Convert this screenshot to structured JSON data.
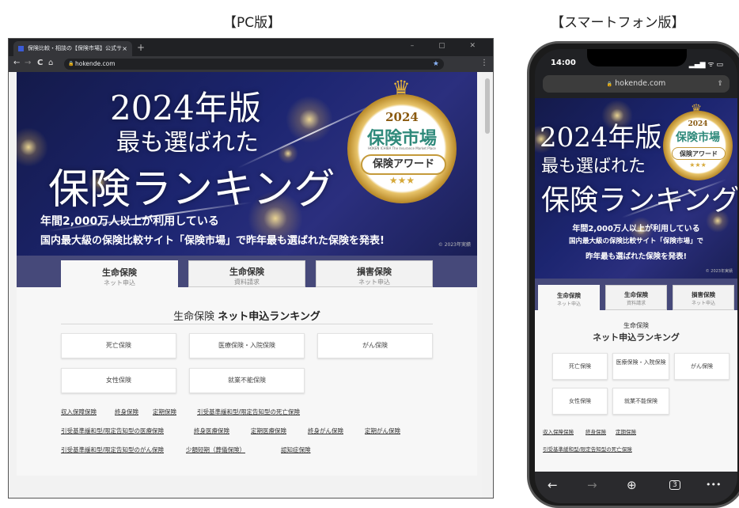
{
  "captions": {
    "pc": "【PC版】",
    "sp": "【スマートフォン版】"
  },
  "browser": {
    "tab_title": "保険比較・相談の【保険市場】公式サ",
    "tab_close": "×",
    "new_tab": "+",
    "window_controls": "–  ▢  ✕",
    "back": "←",
    "forward": "→",
    "reload": "C",
    "home": "⌂",
    "url": "hokende.com",
    "menu": "⋮"
  },
  "banner": {
    "line1": "2024年版",
    "line2": "最も選ばれた",
    "line3": "保険ランキング",
    "sub1": "年間2,000万人以上が利用している",
    "sub2": "国内最大級の保険比較サイト「保険市場」で昨年最も選ばれた保険を発表!",
    "sub2_sp_a": "国内最大級の保険比較サイト「保険市場」で",
    "sub2_sp_b": "昨年最も選ばれた保険を発表!",
    "copyright": "© 2023年実績",
    "medal_year": "2024",
    "medal_name": "保険市場",
    "medal_en": "HOKEN ICHIBA  The Insurance Market Place",
    "medal_award": "保険アワード",
    "medal_stars": "★★★"
  },
  "tabs": [
    {
      "title": "生命保険",
      "sub": "ネット申込"
    },
    {
      "title": "生命保険",
      "sub": "資料請求"
    },
    {
      "title": "損害保険",
      "sub": "ネット申込"
    }
  ],
  "section": {
    "prefix": "生命保険",
    "title": "ネット申込ランキング"
  },
  "categories": [
    "死亡保険",
    "医療保険・入院保険",
    "がん保険",
    "女性保険",
    "就業不能保険"
  ],
  "links_pc": [
    [
      "収入保障保険",
      "終身保険",
      "定期保険",
      "引受基準緩和型/限定告知型の死亡保険"
    ],
    [
      "引受基準緩和型/限定告知型の医療保険",
      "終身医療保険",
      "定期医療保険",
      "終身がん保険",
      "定期がん保険"
    ],
    [
      "引受基準緩和型/限定告知型のがん保険",
      "少額短期（葬儀保険）",
      "認知症保険"
    ]
  ],
  "links_sp": [
    [
      "収入保障保険",
      "終身保険",
      "定期保険"
    ],
    [
      "引受基準緩和型/限定告知型の死亡保険"
    ]
  ],
  "phone": {
    "time": "14:00",
    "status_icons": "▂▄▆ ᯤ ▭",
    "url": "hokende.com",
    "share": "⇪",
    "toolbar": {
      "back": "←",
      "forward": "→",
      "new": "⊕",
      "tabs": "3",
      "more": "•••"
    }
  }
}
